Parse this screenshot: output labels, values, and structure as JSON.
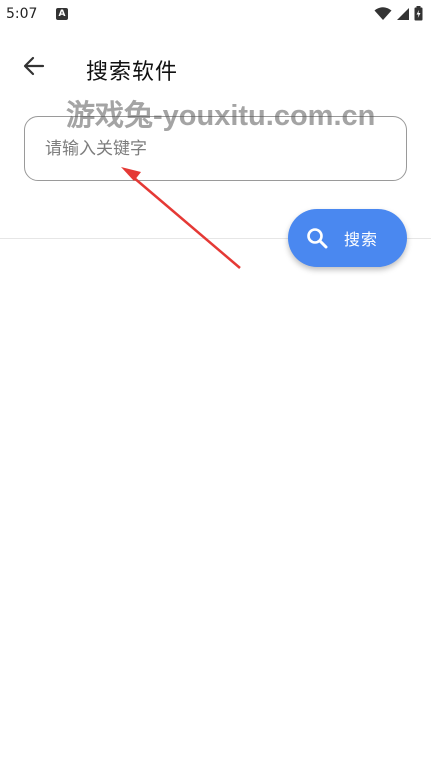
{
  "status_bar": {
    "time": "5:07",
    "notification_icon": "a-badge-icon",
    "icons": [
      "wifi-icon",
      "signal-icon",
      "battery-icon"
    ]
  },
  "app_bar": {
    "back_icon": "arrow-left-icon",
    "title": "搜索软件"
  },
  "watermark": {
    "text": "游戏兔-youxitu.com.cn"
  },
  "search": {
    "placeholder": "请输入关键字",
    "value": ""
  },
  "fab": {
    "icon": "search-icon",
    "label": "搜索",
    "color": "#4a88f0"
  },
  "annotation": {
    "arrow_color": "#e53935"
  }
}
